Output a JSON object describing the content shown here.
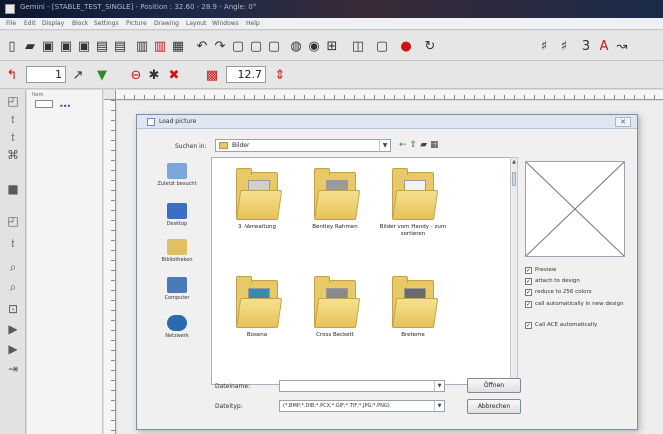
{
  "window": {
    "title": "Gemini - [STABLE_TEST_SINGLE] - Position : 32.60 - 28.9 - Angle: 0°"
  },
  "menu": [
    "File",
    "Edit",
    "Display",
    "Block",
    "Settings",
    "Picture",
    "Drawing",
    "Layout",
    "Windows",
    "Help"
  ],
  "toolbar2": {
    "value1": "1",
    "value2": "12.7"
  },
  "panel": {
    "label": "Item"
  },
  "dialog": {
    "title": "Load picture",
    "close_glyph": "✕",
    "look_in_label": "Suchen in:",
    "look_in_value": "Bilder",
    "places": [
      {
        "label": "Zuletzt besucht",
        "color": "#7aa6d8"
      },
      {
        "label": "Desktop",
        "color": "#3a6fc4"
      },
      {
        "label": "Bibliotheken",
        "color": "#e0c060"
      },
      {
        "label": "Computer",
        "color": "#4a7ab8"
      },
      {
        "label": "Netzwerk",
        "color": "#2a6ab0"
      }
    ],
    "folders": [
      {
        "label": "3 -Verwaltung",
        "thumb": "#d0d0d0"
      },
      {
        "label": "Bentley Rahmen",
        "thumb": "#9a9a9a"
      },
      {
        "label": "Bilder vom Handy - zum sortieren",
        "thumb": "#f2f2f2"
      },
      {
        "label": "Bosena",
        "thumb": "#3a8ab0"
      },
      {
        "label": "Cross Beckett",
        "thumb": "#8a8a8a"
      },
      {
        "label": "Breteme",
        "thumb": "#6a6a6a"
      }
    ],
    "options": [
      {
        "label": "Preview",
        "checked": true
      },
      {
        "label": "attach to design",
        "checked": true
      },
      {
        "label": "reduce to 256 colors",
        "checked": true
      },
      {
        "label": "call automatically in new design",
        "checked": true
      },
      {
        "label": "Call ACE automatically",
        "checked": true
      }
    ],
    "filename_label": "Dateiname:",
    "filename_value": "",
    "filetype_label": "Dateityp:",
    "filetype_value": "(*.BMP;*.DIB;*.PCX;*.GIF;*.TIF;*.JPG;*.PNG)",
    "open_label": "Öffnen",
    "cancel_label": "Abbrechen"
  }
}
